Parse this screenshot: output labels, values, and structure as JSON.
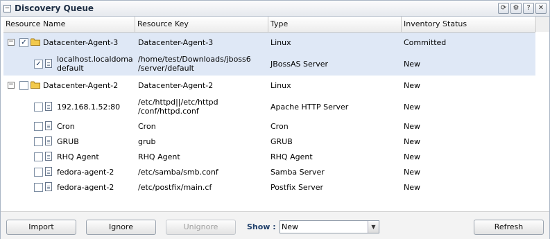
{
  "window": {
    "title": "Discovery Queue",
    "collapse_glyph": "−",
    "tool_icons": [
      "refresh-icon",
      "settings-icon",
      "help-icon",
      "close-icon"
    ],
    "tool_glyphs": [
      "⟳",
      "⚙",
      "?",
      "✕"
    ]
  },
  "columns": [
    "Resource Name",
    "Resource Key",
    "Type",
    "Inventory Status"
  ],
  "rows": [
    {
      "name": "Datacenter-Agent-3",
      "key": "Datacenter-Agent-3",
      "type": "Linux",
      "status": "Committed",
      "icon": "folder-icon",
      "checked": "✓",
      "toggle": "−",
      "selected": true
    },
    {
      "name": "localhost.localdoma\ndefault",
      "key": "/home/test/Downloads/jboss6\n/server/default",
      "type": "JBossAS Server",
      "status": "New",
      "icon": "document-icon",
      "checked": "✓",
      "toggle": "",
      "selected": true
    },
    {
      "name": "Datacenter-Agent-2",
      "key": "Datacenter-Agent-2",
      "type": "Linux",
      "status": "New",
      "icon": "folder-icon",
      "checked": "",
      "toggle": "−",
      "selected": false
    },
    {
      "name": "192.168.1.52:80",
      "key": "/etc/httpd||/etc/httpd\n/conf/httpd.conf",
      "type": "Apache HTTP Server",
      "status": "New",
      "icon": "document-icon",
      "checked": "",
      "toggle": "",
      "selected": false
    },
    {
      "name": "Cron",
      "key": "Cron",
      "type": "Cron",
      "status": "New",
      "icon": "document-icon",
      "checked": "",
      "toggle": "",
      "selected": false
    },
    {
      "name": "GRUB",
      "key": "grub",
      "type": "GRUB",
      "status": "New",
      "icon": "document-icon",
      "checked": "",
      "toggle": "",
      "selected": false
    },
    {
      "name": "RHQ Agent",
      "key": "RHQ Agent",
      "type": "RHQ Agent",
      "status": "New",
      "icon": "document-icon",
      "checked": "",
      "toggle": "",
      "selected": false
    },
    {
      "name": "fedora-agent-2",
      "key": "/etc/samba/smb.conf",
      "type": "Samba Server",
      "status": "New",
      "icon": "document-icon",
      "checked": "",
      "toggle": "",
      "selected": false
    },
    {
      "name": "fedora-agent-2",
      "key": "/etc/postfix/main.cf",
      "type": "Postfix Server",
      "status": "New",
      "icon": "document-icon",
      "checked": "",
      "toggle": "",
      "selected": false
    }
  ],
  "footer": {
    "import_label": "Import",
    "ignore_label": "Ignore",
    "unignore_label": "Unignore",
    "show_label": "Show :",
    "show_value": "New",
    "show_arrow": "▼",
    "refresh_label": "Refresh"
  },
  "colors": {
    "selected_row": "#dfe8f6",
    "accent": "#1f3f6a",
    "folder": "#f2c94c"
  }
}
